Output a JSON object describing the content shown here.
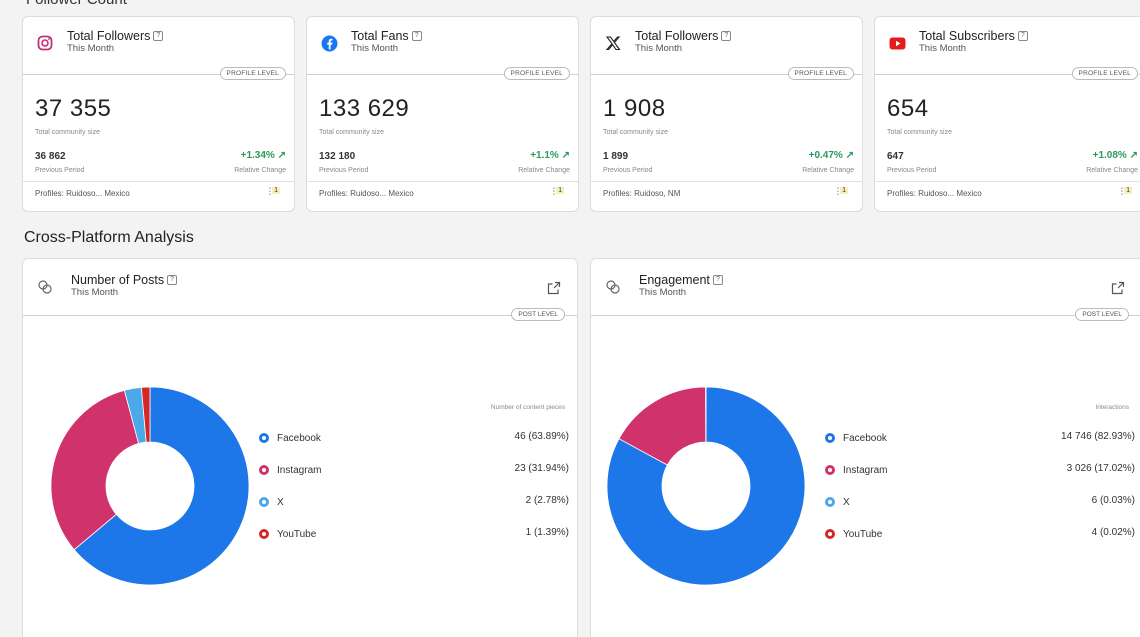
{
  "top_section_title": "Follower Count",
  "kpis": [
    {
      "platform": "Instagram",
      "icon": "instagram-icon",
      "title": "Total Followers",
      "period": "This Month",
      "badge": "PROFILE LEVEL",
      "value": "37 355",
      "value_label": "Total community size",
      "prev_value": "36 862",
      "prev_label": "Previous Period",
      "change": "+1.34%",
      "change_label": "Relative Change",
      "profiles": "Profiles: Ruidoso... Mexico",
      "filter_count": "1"
    },
    {
      "platform": "Facebook",
      "icon": "facebook-icon",
      "title": "Total Fans",
      "period": "This Month",
      "badge": "PROFILE LEVEL",
      "value": "133 629",
      "value_label": "Total community size",
      "prev_value": "132 180",
      "prev_label": "Previous Period",
      "change": "+1.1%",
      "change_label": "Relative Change",
      "profiles": "Profiles: Ruidoso... Mexico",
      "filter_count": "1"
    },
    {
      "platform": "X",
      "icon": "x-icon",
      "title": "Total Followers",
      "period": "This Month",
      "badge": "PROFILE LEVEL",
      "value": "1 908",
      "value_label": "Total community size",
      "prev_value": "1 899",
      "prev_label": "Previous Period",
      "change": "+0.47%",
      "change_label": "Relative Change",
      "profiles": "Profiles: Ruidoso, NM",
      "filter_count": "1"
    },
    {
      "platform": "YouTube",
      "icon": "youtube-icon",
      "title": "Total Subscribers",
      "period": "This Month",
      "badge": "PROFILE LEVEL",
      "value": "654",
      "value_label": "Total community size",
      "prev_value": "647",
      "prev_label": "Previous Period",
      "change": "+1.08%",
      "change_label": "Relative Change",
      "profiles": "Profiles: Ruidoso... Mexico",
      "filter_count": "1"
    }
  ],
  "cross_platform_title": "Cross-Platform Analysis",
  "colors": {
    "facebook": "#1e77e8",
    "instagram": "#d0336b",
    "x": "#4aa9e8",
    "youtube": "#d42828"
  },
  "panels": [
    {
      "title": "Number of Posts",
      "period": "This Month",
      "badge": "POST LEVEL",
      "legend_header": "Number of content pieces",
      "rows": [
        {
          "name": "Facebook",
          "value": "46 (63.89%)"
        },
        {
          "name": "Instagram",
          "value": "23 (31.94%)"
        },
        {
          "name": "X",
          "value": "2 (2.78%)"
        },
        {
          "name": "YouTube",
          "value": "1 (1.39%)"
        }
      ]
    },
    {
      "title": "Engagement",
      "period": "This Month",
      "badge": "POST LEVEL",
      "legend_header": "Interactions",
      "rows": [
        {
          "name": "Facebook",
          "value": "14 746 (82.93%)"
        },
        {
          "name": "Instagram",
          "value": "3 026 (17.02%)"
        },
        {
          "name": "X",
          "value": "6 (0.03%)"
        },
        {
          "name": "YouTube",
          "value": "4 (0.02%)"
        }
      ]
    }
  ],
  "chart_data": [
    {
      "type": "pie",
      "title": "Number of Posts",
      "categories": [
        "Facebook",
        "Instagram",
        "X",
        "YouTube"
      ],
      "values": [
        46,
        23,
        2,
        1
      ],
      "percent": [
        63.89,
        31.94,
        2.78,
        1.39
      ]
    },
    {
      "type": "pie",
      "title": "Engagement",
      "categories": [
        "Facebook",
        "Instagram",
        "X",
        "YouTube"
      ],
      "values": [
        14746,
        3026,
        6,
        4
      ],
      "percent": [
        82.93,
        17.02,
        0.03,
        0.02
      ]
    }
  ]
}
